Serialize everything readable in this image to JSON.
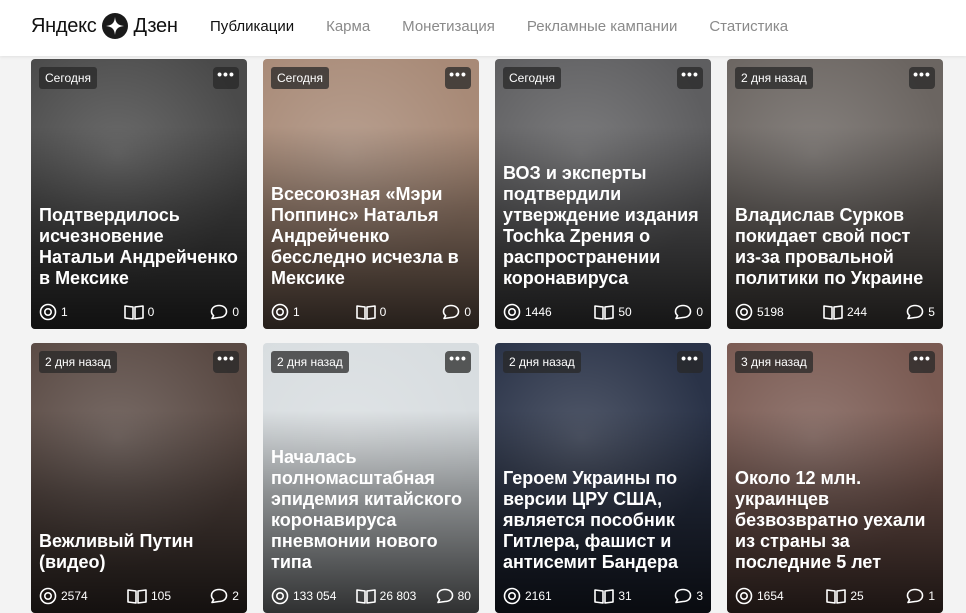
{
  "logo": {
    "left": "Яндекс",
    "right": "Дзен"
  },
  "nav": [
    {
      "label": "Публикации",
      "active": true
    },
    {
      "label": "Карма",
      "active": false
    },
    {
      "label": "Монетизация",
      "active": false
    },
    {
      "label": "Рекламные кампании",
      "active": false
    },
    {
      "label": "Статистика",
      "active": false
    }
  ],
  "cards": [
    {
      "badge": "Сегодня",
      "menu": "•••",
      "title": "Подтвердилось исчезновение Натальи Андрейченко в Мексике",
      "views": "1",
      "reads": "0",
      "comments": "0",
      "bg": "#4a4a4a"
    },
    {
      "badge": "Сегодня",
      "menu": "•••",
      "title": "Всесоюзная «Мэри Поппинс» Наталья Андрейченко бесследно исчезла в Мексике",
      "views": "1",
      "reads": "0",
      "comments": "0",
      "bg": "#a88a77"
    },
    {
      "badge": "Сегодня",
      "menu": "•••",
      "title": "ВОЗ и эксперты подтвердили утверждение издания Tochka Zрения о распространении коронавируса",
      "views": "1446",
      "reads": "50",
      "comments": "0",
      "bg": "#5e5e60"
    },
    {
      "badge": "2 дня назад",
      "menu": "•••",
      "title": "Владислав Сурков покидает свой пост из-за провальной политики по Украине",
      "views": "5198",
      "reads": "244",
      "comments": "5",
      "bg": "#6b6561"
    },
    {
      "badge": "2 дня назад",
      "menu": "•••",
      "title": "Вежливый Путин (видео)",
      "views": "2574",
      "reads": "105",
      "comments": "2",
      "bg": "#5a4a44"
    },
    {
      "badge": "2 дня назад",
      "menu": "•••",
      "title": "Началась полномасштабная эпидемия китайского коронавируса пневмонии нового типа",
      "views": "133 054",
      "reads": "26 803",
      "comments": "80",
      "bg": "#d8dde0"
    },
    {
      "badge": "2 дня назад",
      "menu": "•••",
      "title": "Героем Украины по версии ЦРУ США, является пособник Гитлера, фашист и антисемит Бандера",
      "views": "2161",
      "reads": "31",
      "comments": "3",
      "bg": "#2a3348"
    },
    {
      "badge": "3 дня назад",
      "menu": "•••",
      "title": "Около 12 млн. украинцев безвозвратно уехали из страны за последние 5 лет",
      "views": "1654",
      "reads": "25",
      "comments": "1",
      "bg": "#7a5a52"
    }
  ],
  "colors": {
    "accent": "#111111",
    "nav_inactive": "#8a8a8a",
    "page_bg": "#f3f3f3"
  },
  "icons": {
    "views": "eye-icon",
    "reads": "book-icon",
    "comments": "comment-icon",
    "menu": "more-dots-icon"
  }
}
